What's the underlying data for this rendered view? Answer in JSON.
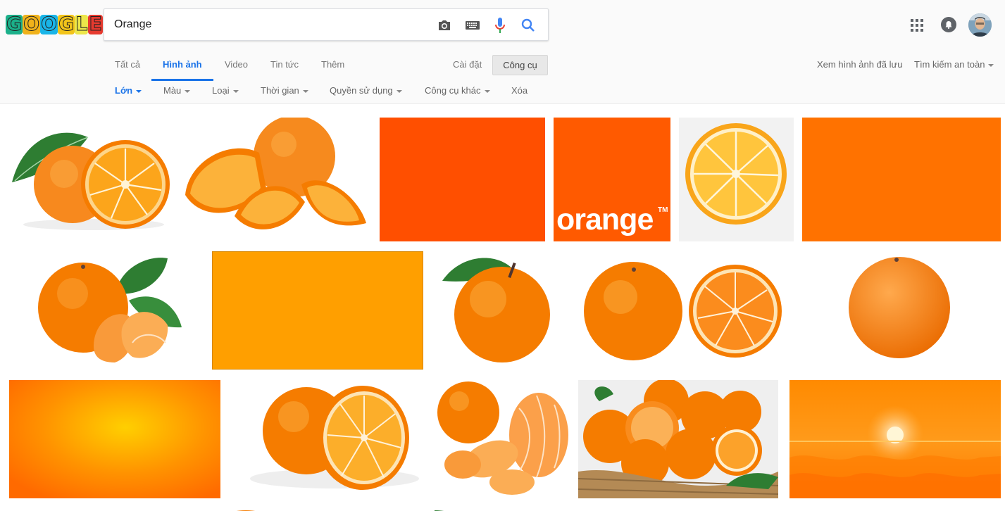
{
  "search": {
    "query": "Orange"
  },
  "tabs": [
    "Tất cả",
    "Hình ảnh",
    "Video",
    "Tin tức",
    "Thêm"
  ],
  "settings_label": "Cài đặt",
  "tools_label": "Công cụ",
  "saved_images_label": "Xem hình ảnh đã lưu",
  "safe_search_label": "Tìm kiếm an toàn",
  "filters": [
    "Lớn",
    "Màu",
    "Loại",
    "Thời gian",
    "Quyền sử dụng",
    "Công cụ khác",
    "Xóa"
  ],
  "logo_letters": [
    {
      "ch": "G",
      "color": "#1bb08a"
    },
    {
      "ch": "O",
      "color": "#f0b21b"
    },
    {
      "ch": "O",
      "color": "#19b5e8"
    },
    {
      "ch": "G",
      "color": "#f2c41a"
    },
    {
      "ch": "L",
      "color": "#ece64a"
    },
    {
      "ch": "E",
      "color": "#e63a2f"
    }
  ],
  "brand_tile": {
    "text": "orange",
    "trademark": "TM"
  },
  "colors": {
    "accent": "#1a73e8",
    "orange_red": "#ff4f00",
    "orange": "#ff7200",
    "amber": "#ff9f00"
  }
}
